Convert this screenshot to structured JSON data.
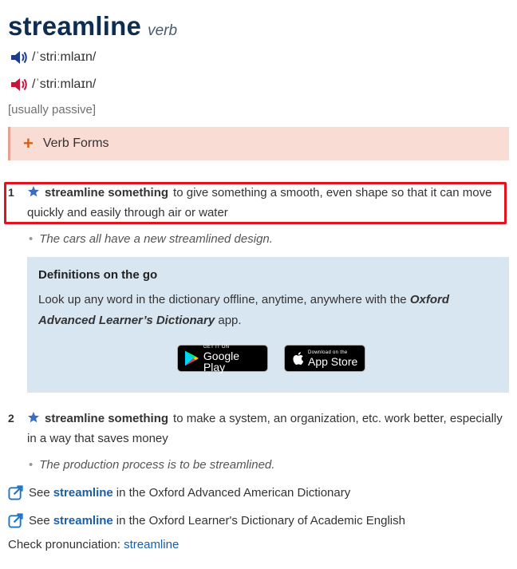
{
  "entry": {
    "headword": "streamline",
    "pos": "verb",
    "pron_br": "/ˈstriːmlaɪn/",
    "pron_am": "/ˈstriːmlaɪn/",
    "grammar": "[usually passive]",
    "verb_forms_label": "Verb Forms",
    "colors": {
      "headword": "#0d2d52",
      "br_speaker": "#1c3b8a",
      "am_speaker": "#c4173a",
      "highlight": "#e3121d"
    }
  },
  "senses": [
    {
      "num": "1",
      "cf": "streamline something",
      "def": "to give something a smooth, even shape so that it can move quickly and easily through air or water",
      "example": "The cars all have a new streamlined design."
    },
    {
      "num": "2",
      "cf": "streamline something",
      "def": "to make a system, an organization, etc. work better, especially in a way that saves money",
      "example": "The production process is to be streamlined."
    }
  ],
  "promo": {
    "title": "Definitions on the go",
    "body_pre": "Look up any word in the dictionary offline, anytime, anywhere with the ",
    "body_bold": "Oxford Advanced Learner’s Dictionary",
    "body_post": " app.",
    "google_small": "GET IT ON",
    "google_big": "Google Play",
    "apple_small": "Download on the",
    "apple_big": "App Store"
  },
  "xrefs": [
    {
      "pre": "See",
      "link": "streamline",
      "post": "in the Oxford Advanced American Dictionary"
    },
    {
      "pre": "See",
      "link": "streamline",
      "post": "in the Oxford Learner's Dictionary of Academic English"
    }
  ],
  "check": {
    "label": "Check pronunciation:",
    "link": "streamline"
  }
}
